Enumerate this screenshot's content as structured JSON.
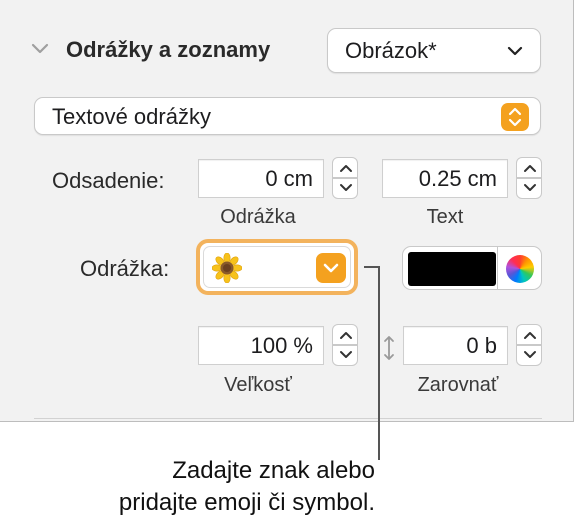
{
  "section": {
    "title": "Odrážky a zoznamy",
    "style_popup_value": "Obrázok*"
  },
  "bullet_type": {
    "value": "Textové odrážky"
  },
  "indent": {
    "label": "Odsadenie:",
    "bullet_value": "0 cm",
    "bullet_sublabel": "Odrážka",
    "text_value": "0.25 cm",
    "text_sublabel": "Text"
  },
  "bullet": {
    "label": "Odrážka:",
    "selected_icon": "sunflower-emoji-icon",
    "color_well": {
      "color": "#000000"
    }
  },
  "size": {
    "value": "100 %",
    "sublabel": "Veľkosť"
  },
  "align": {
    "value": "0 b",
    "sublabel": "Zarovnať"
  },
  "callout": {
    "line1": "Zadajte znak alebo",
    "line2": "pridajte emoji či symbol."
  },
  "colors": {
    "accent": "#f4a11f",
    "focus_ring": "#f3b35d",
    "panel_bg": "#f2f2f2"
  }
}
